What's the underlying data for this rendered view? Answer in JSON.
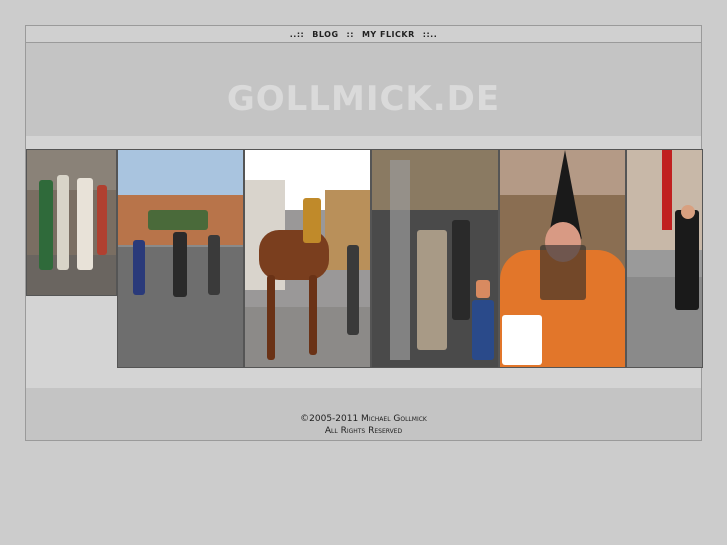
{
  "nav": {
    "left_deco": "..::",
    "blog": "BLOG",
    "sep": "::",
    "flickr": "MY FLICKR",
    "right_deco": "::.."
  },
  "header": {
    "logo": "GOLLMICK.DE"
  },
  "gallery": {
    "photos": [
      {
        "icon": "photo-procession-women"
      },
      {
        "icon": "photo-parade-square"
      },
      {
        "icon": "photo-horse-rider"
      },
      {
        "icon": "photo-stage-costumes"
      },
      {
        "icon": "photo-witch-costume"
      },
      {
        "icon": "photo-street-figure"
      }
    ]
  },
  "footer": {
    "copyright": "©2005-2011 Michael Gollmick",
    "rights": "All Rights Reserved"
  },
  "colors": {
    "page_bg": "#cccccc",
    "frame_bg": "#c4c4c4",
    "band_bg": "#d4d4d4",
    "logo": "#dadada"
  }
}
